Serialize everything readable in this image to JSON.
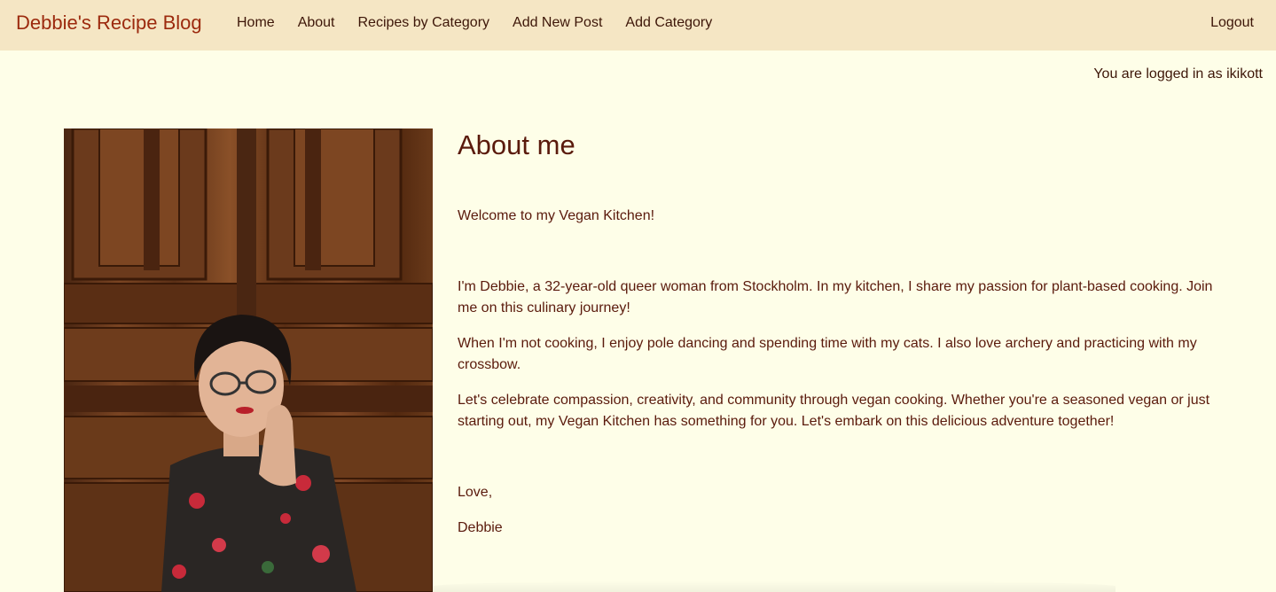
{
  "navbar": {
    "brand": "Debbie's Recipe Blog",
    "links": [
      "Home",
      "About",
      "Recipes by Category",
      "Add New Post",
      "Add Category"
    ],
    "logout": "Logout"
  },
  "status": {
    "logged_in_text": "You are logged in as ikikott"
  },
  "about": {
    "title": "About me",
    "welcome": "Welcome to my Vegan Kitchen!",
    "p1": "I'm Debbie, a 32-year-old queer woman from Stockholm. In my kitchen, I share my passion for plant-based cooking. Join me on this culinary journey!",
    "p2": "When I'm not cooking, I enjoy pole dancing and spending time with my cats. I also love archery and practicing with my crossbow.",
    "p3": "Let's celebrate compassion, creativity, and community through vegan cooking. Whether you're a seasoned vegan or just starting out, my Vegan Kitchen has something for you. Let's embark on this delicious adventure together!",
    "signoff": "Love,",
    "signature": "Debbie"
  },
  "colors": {
    "navbar_bg": "#f5e6c4",
    "page_bg": "#fefee8",
    "brand": "#9c2a0e",
    "text": "#5a1a0c"
  }
}
